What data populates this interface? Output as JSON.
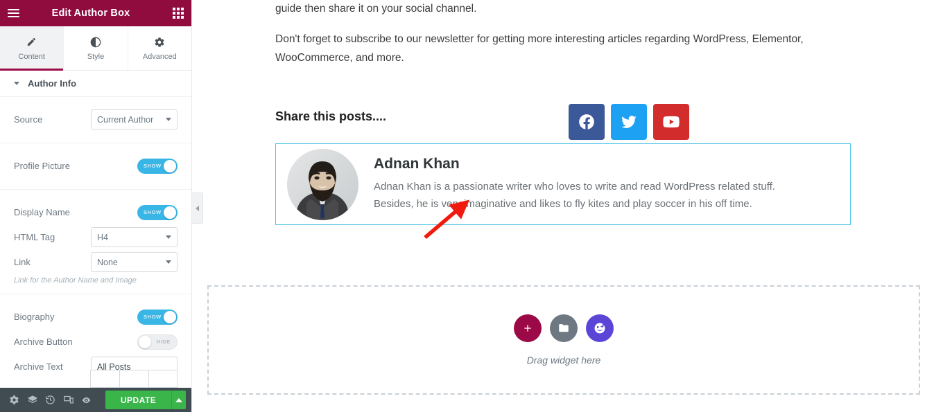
{
  "panel": {
    "title": "Edit Author Box",
    "menu_icon": "hamburger-icon",
    "widgets_icon": "grid-icon",
    "tabs": [
      {
        "label": "Content",
        "icon": "pencil-icon",
        "active": true
      },
      {
        "label": "Style",
        "icon": "contrast-circle-icon",
        "active": false
      },
      {
        "label": "Advanced",
        "icon": "gear-icon",
        "active": false
      }
    ],
    "section": {
      "label": "Author Info",
      "expanded": true
    },
    "controls": {
      "source": {
        "label": "Source",
        "value": "Current Author"
      },
      "profile_picture": {
        "label": "Profile Picture",
        "state": "SHOW",
        "on": true
      },
      "display_name": {
        "label": "Display Name",
        "state": "SHOW",
        "on": true
      },
      "html_tag": {
        "label": "HTML Tag",
        "value": "H4"
      },
      "link": {
        "label": "Link",
        "value": "None",
        "description": "Link for the Author Name and Image"
      },
      "biography": {
        "label": "Biography",
        "state": "SHOW",
        "on": true
      },
      "archive_button": {
        "label": "Archive Button",
        "state": "HIDE",
        "on": false
      },
      "archive_text": {
        "label": "Archive Text",
        "value": "All Posts",
        "placeholder": "All Posts"
      }
    },
    "footer": {
      "icons": [
        "settings-gear-icon",
        "navigator-layers-icon",
        "history-clock-icon",
        "responsive-mode-icon",
        "preview-eye-icon"
      ],
      "update_label": "UPDATE",
      "update_caret": "caret-up-icon"
    },
    "collapse_icon": "chevron-left-icon",
    "colors": {
      "header_bg": "#900c3f",
      "accent": "#9b0a46",
      "toggle_on": "#39b5e6",
      "update_green": "#39b54a",
      "footer_bg": "#404b52"
    }
  },
  "canvas": {
    "paragraph_1": "guide then share it on your social channel.",
    "paragraph_2": "Don't forget to subscribe to our newsletter for getting more interesting articles regarding WordPress, Elementor, WooCommerce, and more.",
    "share": {
      "title": "Share this posts....",
      "buttons": [
        {
          "name": "facebook-icon",
          "color": "#3b5998"
        },
        {
          "name": "twitter-icon",
          "color": "#1da1f2"
        },
        {
          "name": "youtube-icon",
          "color": "#d32c2c"
        }
      ]
    },
    "author_box": {
      "avatar_alt": "author-avatar",
      "name": "Adnan Khan",
      "bio_line_1": "Adnan Khan is a passionate writer who loves to write and read WordPress related stuff.",
      "bio_line_2": "Besides, he is very imaginative and likes to fly kites and play soccer in his off time.",
      "border_color": "#56c5e8"
    },
    "dropzone": {
      "label": "Drag widget here",
      "buttons": [
        {
          "name": "add-section-icon",
          "color": "#9b0a46"
        },
        {
          "name": "template-folder-icon",
          "color": "#6d7882"
        },
        {
          "name": "elementor-ai-icon",
          "color": "#5b45d6"
        }
      ]
    },
    "annotation": {
      "name": "red-arrow",
      "color": "#f01b0e"
    }
  }
}
